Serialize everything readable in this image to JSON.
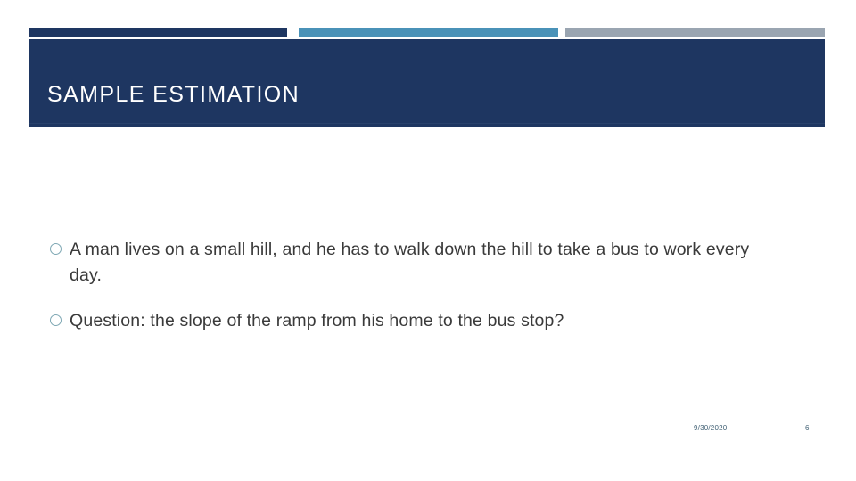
{
  "slide": {
    "title": "SAMPLE ESTIMATION",
    "theme": {
      "navy": "#1e3661",
      "blue": "#4a92b8",
      "gray": "#9aa5b1",
      "title_text": "#ffffff",
      "body_text": "#3a3a3a",
      "bullet_marker": "#7fa8b4",
      "footer_text": "#3f5f73",
      "background": "#ffffff"
    },
    "accent_bars": [
      {
        "name": "navy-bar",
        "color": "#1e3661"
      },
      {
        "name": "blue-bar",
        "color": "#4a92b8"
      },
      {
        "name": "gray-bar",
        "color": "#9aa5b1"
      }
    ],
    "bullets": [
      {
        "marker": "hollow-circle-bullet",
        "text": "A man lives on a small hill, and he has to walk down the hill to take a bus to work every day."
      },
      {
        "marker": "hollow-circle-bullet",
        "text": "Question: the slope of the ramp from his home to the bus stop?"
      }
    ],
    "footer": {
      "date": "9/30/2020",
      "page_number": "6"
    }
  }
}
